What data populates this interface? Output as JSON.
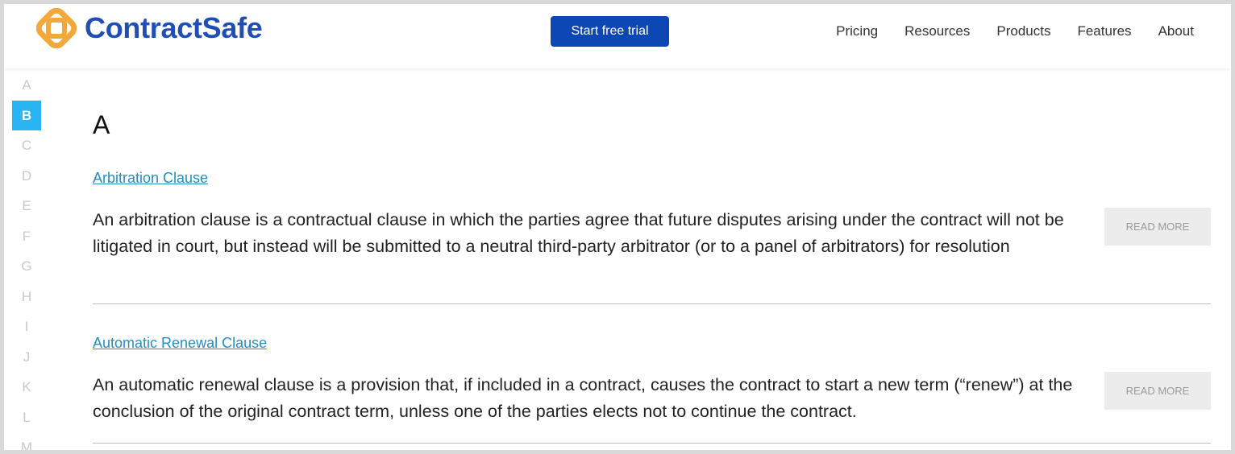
{
  "brand": {
    "name": "ContractSafe",
    "colors": {
      "primary": "#1f4fb5",
      "logo_orange": "#f3a83b",
      "accent": "#29b5f3",
      "button": "#0d47b3",
      "link": "#1f8fc1"
    }
  },
  "header": {
    "cta_label": "Start free trial",
    "nav": [
      "Pricing",
      "Resources",
      "Products",
      "Features",
      "About"
    ]
  },
  "alphabet": {
    "letters": [
      "A",
      "B",
      "C",
      "D",
      "E",
      "F",
      "G",
      "H",
      "I",
      "J",
      "K",
      "L",
      "M"
    ],
    "active": "B"
  },
  "section": {
    "letter": "A"
  },
  "entries": [
    {
      "title": "Arbitration Clause",
      "description": "An arbitration clause is a contractual clause in which the parties agree that future disputes arising under the contract will not be litigated in court, but instead will be submitted to a neutral third-party arbitrator (or to a panel of arbitrators) for resolution",
      "read_more": "READ MORE"
    },
    {
      "title": "Automatic Renewal Clause",
      "description": "An automatic renewal clause is a provision that, if included in a contract, causes the contract to start a new term (“renew”) at the conclusion of the original contract term, unless one of the parties elects not to continue the contract.",
      "read_more": "READ MORE"
    }
  ]
}
